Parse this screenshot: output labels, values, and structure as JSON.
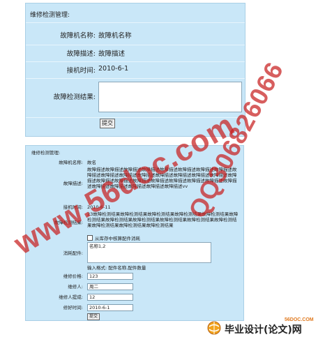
{
  "form1": {
    "title": "维修检测管理:",
    "fields": [
      {
        "label": "故障机名称:",
        "value": "故障机名称"
      },
      {
        "label": "故障描述:",
        "value": "故障描述"
      },
      {
        "label": "接机时间:",
        "value": "2010-6-1"
      },
      {
        "label": "故障检测结果:",
        "value": ""
      }
    ],
    "submit_label": "提交"
  },
  "form2": {
    "title": "维修检测管理:",
    "fault_name_label": "故障机名称:",
    "fault_name_value": "故名",
    "desc_label": "故障描述:",
    "desc_value": "故障描述故障描述故障描述故障描述故障描述故障描述故障描述故障描述故障描述故障描述故障描述故障描述故障描述故障描述故障描述故障描述故障描述故障描述故障描述故障描述故障描述故障描述故障描述故障描述故障描述故障描述故障描述故障描述故障描述故障描述vv",
    "time_label": "接机时间:",
    "time_value": "2010-6-11",
    "result_label": "故障检测结果:",
    "result_value": "23故障检测结果故障检测结果故障检测结果故障检测结果故障检测结果故障检测结果故障检测结果故障检测结果故障检测结果故障检测结果故障检测结果故障检测结果故障检测结果故障检测结果",
    "parts_label": "消耗配件:",
    "checkbox_label": "从库存中核算配件消耗",
    "parts_value": "名称1,2",
    "parts_hint": "输入格式: 配件名称,配件数量",
    "price_label": "维修价格:",
    "price_value": "123",
    "person_label": "维修人:",
    "person_value": "周二",
    "commission_label": "维修人提成:",
    "commission_value": "12",
    "fixed_time_label": "修好时间:",
    "fixed_time_value": "2010-6-1",
    "submit_label": "提交"
  },
  "watermarks": {
    "site": "www.56doc.com",
    "qq": "QQ306826066",
    "small_site": "56DOC.COM",
    "logo_text": "毕业设计(论文)网"
  },
  "colors": {
    "panel": "#c9e7f8",
    "watermark": "#c82020"
  }
}
